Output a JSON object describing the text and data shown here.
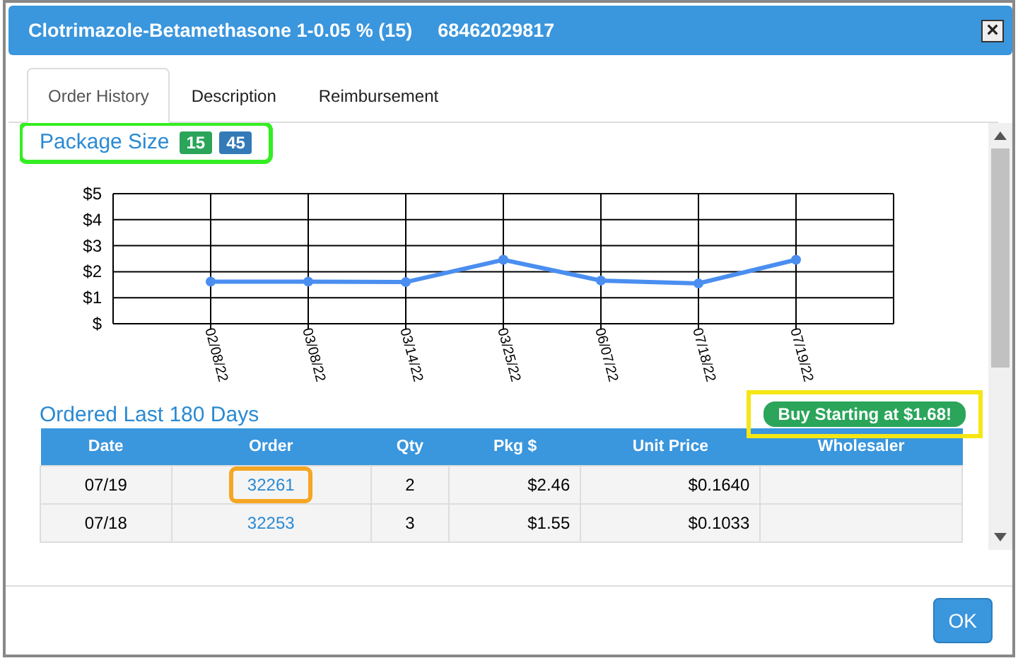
{
  "window": {
    "title": "Clotrimazole-Betamethasone 1-0.05 % (15)",
    "code": "68462029817",
    "close": "×"
  },
  "tabs": [
    {
      "label": "Order History",
      "selected": true
    },
    {
      "label": "Description",
      "selected": false
    },
    {
      "label": "Reimbursement",
      "selected": false
    }
  ],
  "package_size": {
    "label": "Package Size",
    "highlight": {
      "color": "#33ee22"
    },
    "badges": [
      {
        "text": "15",
        "color": "#2aa55a"
      },
      {
        "text": "45",
        "color": "#337ab7"
      }
    ]
  },
  "chart_data": {
    "type": "line",
    "categories": [
      "02/08/22",
      "03/08/22",
      "03/14/22",
      "03/25/22",
      "06/07/22",
      "07/18/22",
      "07/19/22"
    ],
    "grid": true,
    "series": [
      {
        "color": "#4a8ef0",
        "marker": "circle",
        "values": [
          1.62,
          1.62,
          1.6,
          2.46,
          1.66,
          1.55,
          2.46
        ]
      }
    ],
    "ylim": [
      0,
      5
    ],
    "yticks": [
      {
        "value": 0,
        "label": "$"
      },
      {
        "value": 1,
        "label": "$1"
      },
      {
        "value": 2,
        "label": "$2"
      },
      {
        "value": 3,
        "label": "$3"
      },
      {
        "value": 4,
        "label": "$4"
      },
      {
        "value": 5,
        "label": "$5"
      }
    ]
  },
  "orders": {
    "title": "Ordered Last 180 Days",
    "buy_button": {
      "label": "Buy Starting at $1.68!",
      "highlight": {
        "color": "#f5e614"
      }
    },
    "columns": [
      "Date",
      "Order",
      "Qty",
      "Pkg $",
      "Unit Price",
      "Wholesaler"
    ],
    "rows": [
      {
        "date": "07/19",
        "order": "32261",
        "qty": "2",
        "pkg": "$2.46",
        "unit_price": "$0.1640",
        "highlight": {
          "color": "#f5a623"
        }
      },
      {
        "date": "07/18",
        "order": "32253",
        "qty": "3",
        "pkg": "$1.55",
        "unit_price": "$0.1033"
      }
    ]
  },
  "buttons": [
    "OK"
  ]
}
